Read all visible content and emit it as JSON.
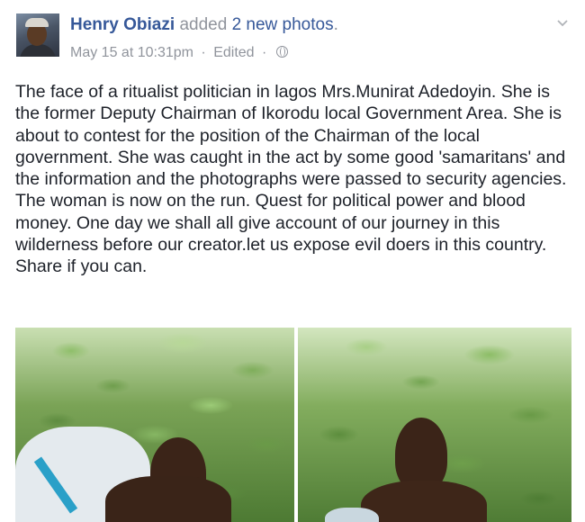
{
  "post": {
    "author": "Henry Obiazi",
    "action_text": "added",
    "photo_count_text": "2 new photos",
    "trailing_period": ".",
    "timestamp": "May 15 at 10:31pm",
    "separator": "·",
    "edited_label": "Edited",
    "privacy_icon": "globe-icon",
    "menu_icon": "chevron-down-icon",
    "body": "The face of a ritualist politician in lagos Mrs.Munirat Adedoyin. She is the former Deputy Chairman of Ikorodu local Government Area. She is about to contest for the position of the Chairman of the local government. She was caught in the act by some good 'samaritans' and the information and the photographs were passed to security agencies. The woman is now on the run. Quest for political power and blood money. One day we shall all give account of our journey in this wilderness before our creator.let us expose evil doers in this country. Share if you can."
  },
  "colors": {
    "author_link": "#365899",
    "meta_gray": "#90949c",
    "body_text": "#1d2129"
  }
}
